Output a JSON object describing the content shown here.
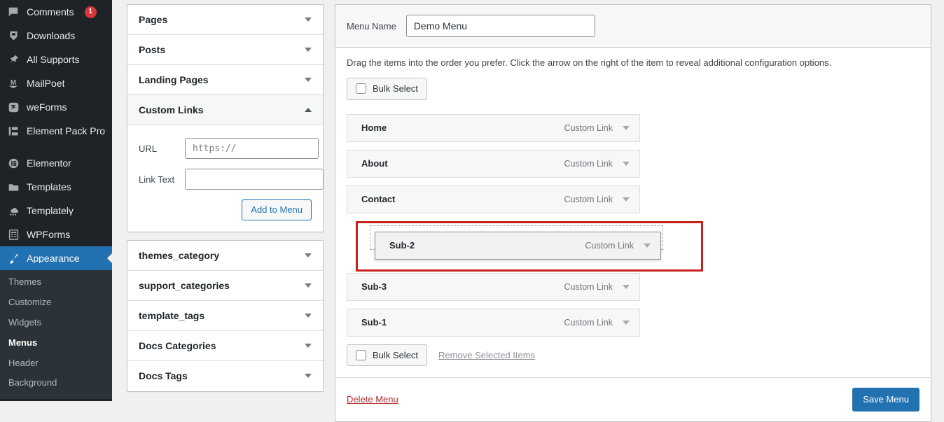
{
  "sidebar": {
    "items": [
      {
        "label": "Comments",
        "icon": "comments-icon",
        "badge": "1"
      },
      {
        "label": "Downloads",
        "icon": "downloads-icon",
        "badge": ""
      },
      {
        "label": "All Supports",
        "icon": "pin-icon",
        "badge": ""
      },
      {
        "label": "MailPoet",
        "icon": "mailpoet-icon",
        "badge": ""
      },
      {
        "label": "weForms",
        "icon": "weforms-icon",
        "badge": ""
      },
      {
        "label": "Element Pack Pro",
        "icon": "element-pack-icon",
        "badge": ""
      },
      {
        "label": "Elementor",
        "icon": "elementor-icon",
        "badge": ""
      },
      {
        "label": "Templates",
        "icon": "folder-icon",
        "badge": ""
      },
      {
        "label": "Templately",
        "icon": "templately-icon",
        "badge": ""
      },
      {
        "label": "WPForms",
        "icon": "wpforms-icon",
        "badge": ""
      }
    ],
    "current": {
      "label": "Appearance",
      "icon": "appearance-brush-icon"
    },
    "submenu": [
      {
        "label": "Themes",
        "active": false
      },
      {
        "label": "Customize",
        "active": false
      },
      {
        "label": "Widgets",
        "active": false
      },
      {
        "label": "Menus",
        "active": true
      },
      {
        "label": "Header",
        "active": false
      },
      {
        "label": "Background",
        "active": false
      }
    ]
  },
  "accordion": {
    "groups_top": [
      {
        "label": "Pages",
        "open": false
      },
      {
        "label": "Posts",
        "open": false
      },
      {
        "label": "Landing Pages",
        "open": false
      }
    ],
    "custom_links": {
      "label": "Custom Links",
      "open": true,
      "url_label": "URL",
      "url_value": "https://",
      "link_text_label": "Link Text",
      "link_text_value": "",
      "add_button": "Add to Menu"
    },
    "groups_bottom": [
      {
        "label": "themes_category",
        "open": false
      },
      {
        "label": "support_categories",
        "open": false
      },
      {
        "label": "template_tags",
        "open": false
      },
      {
        "label": "Docs Categories",
        "open": false
      },
      {
        "label": "Docs Tags",
        "open": false
      }
    ]
  },
  "main": {
    "menu_name_label": "Menu Name",
    "menu_name_value": "Demo Menu",
    "hint": "Drag the items into the order you prefer. Click the arrow on the right of the item to reveal additional configuration options.",
    "bulk_select_top": "Bulk Select",
    "bulk_select_bottom": "Bulk Select",
    "remove_selected": "Remove Selected Items",
    "delete_menu": "Delete Menu",
    "save_menu": "Save Menu",
    "items": [
      {
        "title": "Home",
        "type": "Custom Link",
        "state": "normal"
      },
      {
        "title": "About",
        "type": "Custom Link",
        "state": "normal"
      },
      {
        "title": "Contact",
        "type": "Custom Link",
        "state": "normal"
      },
      {
        "title": "Sub-2",
        "type": "Custom Link",
        "state": "dragging"
      },
      {
        "title": "Sub-3",
        "type": "Custom Link",
        "state": "normal"
      },
      {
        "title": "Sub-1",
        "type": "Custom Link",
        "state": "normal"
      }
    ]
  },
  "colors": {
    "sidebar_bg": "#1d2327",
    "accent": "#2271b1",
    "badge": "#d63638",
    "danger": "#b32d2e",
    "highlight_box": "#c9211e",
    "page_bg": "#f0f0f1"
  }
}
